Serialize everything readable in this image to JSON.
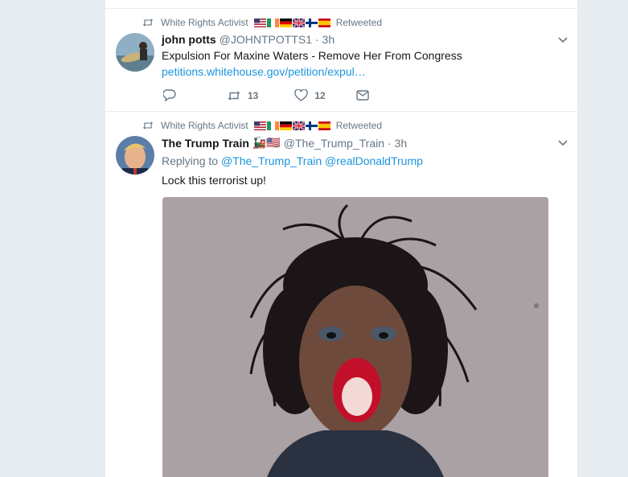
{
  "tweets": [
    {
      "context": {
        "user": "White Rights Activist",
        "flags": [
          "us",
          "ie",
          "de",
          "gb",
          "fi",
          "es"
        ],
        "label": "Retweeted"
      },
      "author": {
        "name": "john potts",
        "handle": "@JOHNTPOTTS1",
        "time": "· 3h"
      },
      "text": "Expulsion For Maxine Waters - Remove Her From Congress",
      "link": "petitions.whitehouse.gov/petition/expul…",
      "actions": {
        "retweets": "13",
        "likes": "12"
      }
    },
    {
      "context": {
        "user": "White Rights Activist",
        "flags": [
          "us",
          "ie",
          "de",
          "gb",
          "fi",
          "es"
        ],
        "label": "Retweeted"
      },
      "author": {
        "name": "The Trump Train",
        "name_emoji": "🚂🇺🇸",
        "handle": "@The_Trump_Train",
        "time": "· 3h"
      },
      "replying": {
        "prefix": "Replying to",
        "mentions": [
          "@The_Trump_Train",
          "@realDonaldTrump"
        ]
      },
      "text": "Lock this terrorist up!"
    }
  ],
  "colors": {
    "link": "#1b95e0",
    "secondary_text": "#657786",
    "background": "#e6ecf0"
  },
  "icons": [
    "retweet-icon",
    "reply-icon",
    "like-icon",
    "dm-icon",
    "chevron-down-icon"
  ]
}
